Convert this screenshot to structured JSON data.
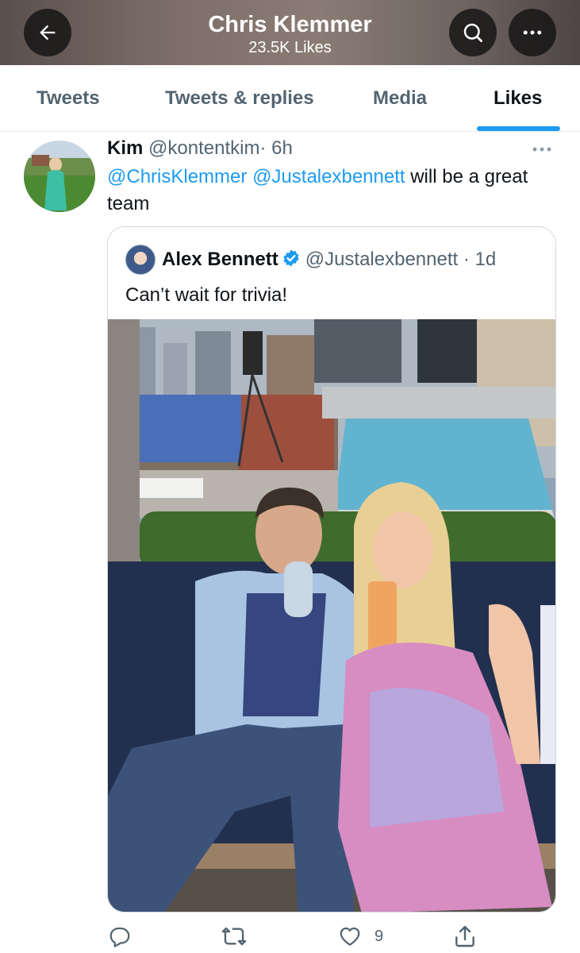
{
  "header": {
    "title": "Chris Klemmer",
    "subtitle": "23.5K Likes",
    "back_icon": "arrow-left-icon",
    "search_icon": "search-icon",
    "more_icon": "more-horizontal-icon"
  },
  "tabs": [
    {
      "label": "Tweets",
      "active": false
    },
    {
      "label": "Tweets & replies",
      "active": false
    },
    {
      "label": "Media",
      "active": false
    },
    {
      "label": "Likes",
      "active": true
    }
  ],
  "tweet": {
    "name": "Kim",
    "handle": "@kontentkim",
    "sep": "·",
    "time": "6h",
    "mention1": "@ChrisKlemmer",
    "mention2": "@Justalexbennett",
    "text": "will be a great team",
    "quote": {
      "name": "Alex Bennett",
      "handle": "@Justalexbennett",
      "sep": "·",
      "time": "1d",
      "text": "Can’t wait for trivia!"
    },
    "actions": {
      "reply_icon": "reply-icon",
      "retweet_icon": "retweet-icon",
      "like_icon": "heart-icon",
      "like_count": "9",
      "share_icon": "share-icon"
    }
  },
  "colors": {
    "accent": "#1d9bf0",
    "text": "#0f1419",
    "muted": "#536471",
    "border": "#cfd9de"
  }
}
